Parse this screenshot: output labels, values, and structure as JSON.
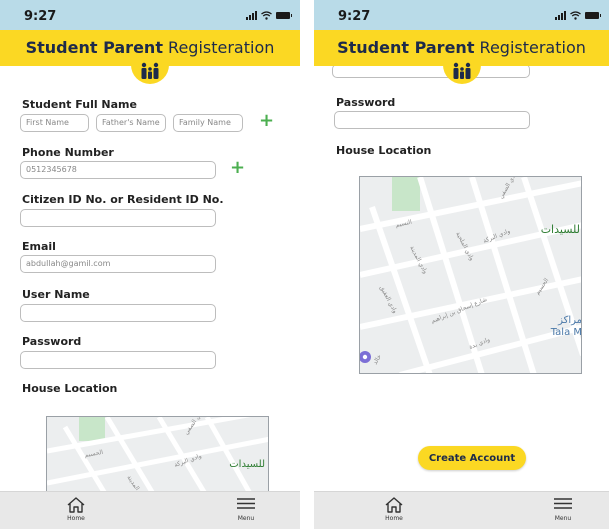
{
  "status_time": "9:27",
  "header": {
    "title_bold": "Student Parent",
    "title_regular": " Registeration"
  },
  "form": {
    "student_full_name_label": "Student Full Name",
    "first_name_placeholder": "First Name",
    "fathers_name_placeholder": "Father's Name",
    "family_name_placeholder": "Family Name",
    "phone_label": "Phone Number",
    "phone_value": "0512345678",
    "citizen_id_label": "Citizen ID No. or Resident ID No.",
    "email_label": "Email",
    "email_value": "abdullah@gamil.com",
    "username_label": "User Name",
    "password_label": "Password",
    "house_location_label": "House Location",
    "create_account_label": "Create Account"
  },
  "map": {
    "poi_arabic": "للسيدات",
    "poi_arabic_2": "مراكز",
    "poi_latin": "Tala M",
    "streets": [
      "وادي الصفي",
      "وادي البركة",
      "وادي المدينة",
      "وادي العقيق",
      "شارع إسحاق بن إبراهيم",
      "وادي الملحية",
      "وادي بدة",
      "النسيم",
      "الحسيم",
      "خالد"
    ]
  },
  "nav": {
    "home_label": "Home",
    "menu_label": "Menu"
  },
  "colors": {
    "accent": "#fbd823",
    "status_bar": "#b9dbe8",
    "plus": "#4caf50"
  },
  "icons": [
    "family-icon",
    "home-icon",
    "menu-icon",
    "plus-icon",
    "location-pin-icon"
  ]
}
